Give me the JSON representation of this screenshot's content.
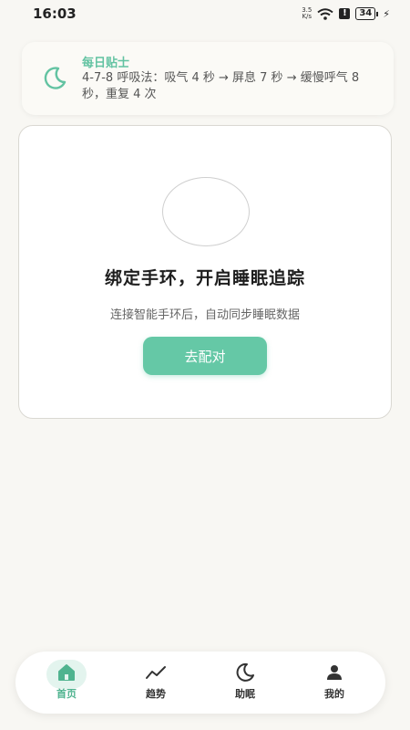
{
  "status_bar": {
    "time": "16:03",
    "speed_top": "3.5",
    "speed_bottom": "K/s",
    "alert": "!",
    "battery": "34",
    "bolt": "⚡"
  },
  "tip": {
    "title": "每日贴士",
    "text": "4-7-8 呼吸法：吸气 4 秒 → 屏息 7 秒 → 缓慢呼气 8 秒，重复 4 次"
  },
  "bind_card": {
    "title": "绑定手环，开启睡眠追踪",
    "subtitle": "连接智能手环后，自动同步睡眠数据",
    "button_label": "去配对"
  },
  "tabs": [
    {
      "label": "首页",
      "icon": "home-icon",
      "active": true
    },
    {
      "label": "趋势",
      "icon": "trend-icon",
      "active": false
    },
    {
      "label": "助眠",
      "icon": "moon-icon",
      "active": false
    },
    {
      "label": "我的",
      "icon": "person-icon",
      "active": false
    }
  ],
  "colors": {
    "accent": "#65c8a6",
    "accent_text": "#63c3a2",
    "background": "#f8f7f3"
  }
}
